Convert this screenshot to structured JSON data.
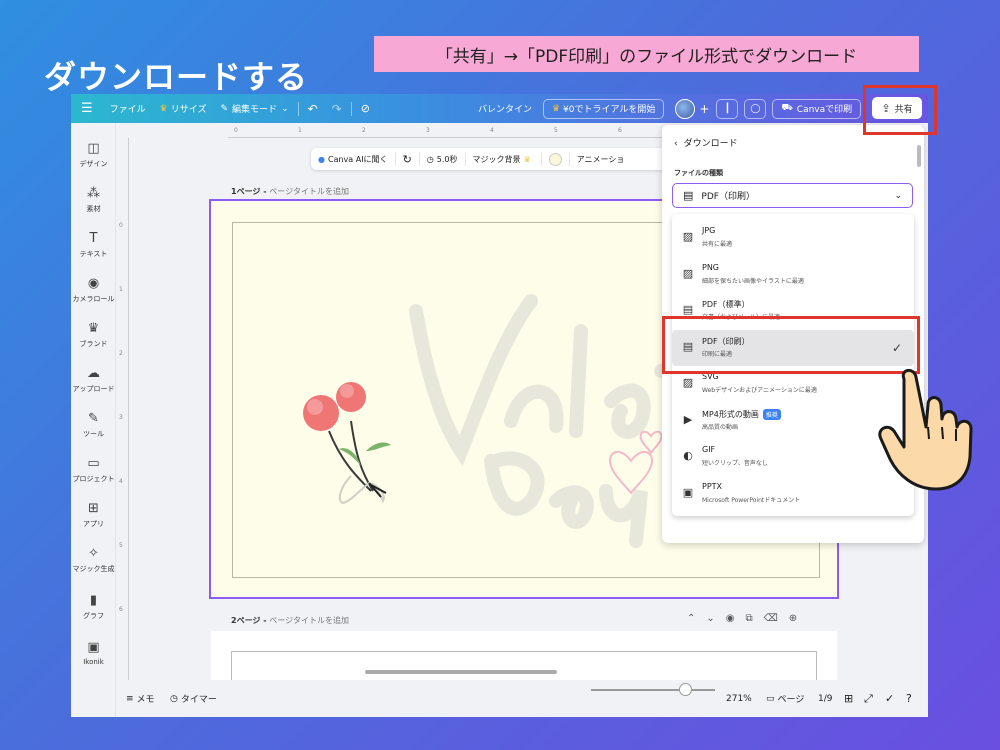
{
  "slide": {
    "title": "ダウンロードする",
    "caption": "「共有」→「PDF印刷」のファイル形式でダウンロード"
  },
  "topbar": {
    "menu_icon": "hamburger-icon",
    "file": "ファイル",
    "resize": "リサイズ",
    "edit_mode": "編集モード",
    "design_name": "バレンタイン",
    "trial": "¥0でトライアルを開始",
    "print": "Canvaで印刷",
    "share": "共有"
  },
  "rail": {
    "items": [
      {
        "label": "デザイン",
        "icon": "layout-icon",
        "glyph": "◫"
      },
      {
        "label": "素材",
        "icon": "shapes-icon",
        "glyph": "⁂"
      },
      {
        "label": "テキスト",
        "icon": "text-icon",
        "glyph": "T"
      },
      {
        "label": "カメラロール",
        "icon": "camera-icon",
        "glyph": "◉"
      },
      {
        "label": "ブランド",
        "icon": "brand-icon",
        "glyph": "♛"
      },
      {
        "label": "アップロード",
        "icon": "cloud-upload-icon",
        "glyph": "☁"
      },
      {
        "label": "ツール",
        "icon": "pen-icon",
        "glyph": "✎"
      },
      {
        "label": "プロジェクト",
        "icon": "folder-icon",
        "glyph": "▭"
      },
      {
        "label": "アプリ",
        "icon": "apps-icon",
        "glyph": "⊞"
      },
      {
        "label": "マジック生成",
        "icon": "magic-icon",
        "glyph": "✧"
      },
      {
        "label": "グラフ",
        "icon": "chart-icon",
        "glyph": "▮"
      },
      {
        "label": "Ikonik",
        "icon": "ikonik-icon",
        "glyph": "▣"
      }
    ]
  },
  "ruler": {
    "top": [
      "0",
      "1",
      "2",
      "3",
      "4",
      "5",
      "6"
    ],
    "left": [
      "0",
      "1",
      "2",
      "3",
      "4",
      "5",
      "6"
    ]
  },
  "context_toolbar": {
    "canva_ai": "Canva AIに聞く",
    "duration": "5.0秒",
    "magic_bg": "マジック背景",
    "animation": "アニメーショ"
  },
  "pages": {
    "page1_num": "1ページ - ",
    "page1_title_ph": "ページタイトルを追加",
    "page2_num": "2ページ - ",
    "page2_title_ph": "ページタイトルを追加"
  },
  "bottombar": {
    "notes": "メモ",
    "timer": "タイマー",
    "zoom": "271%",
    "pages_label": "ページ",
    "page_count": "1/9",
    "zoom_level": 0.76
  },
  "download_panel": {
    "back": "ダウンロード",
    "file_type_label": "ファイルの種類",
    "selected": "PDF（印刷）",
    "options": [
      {
        "title": "JPG",
        "desc": "共有に最適",
        "icon": "image-icon",
        "glyph": "▨"
      },
      {
        "title": "PNG",
        "desc": "細部を保ちたい画像やイラストに最適",
        "icon": "image-icon",
        "glyph": "▨"
      },
      {
        "title": "PDF（標準）",
        "desc": "文書（およびメール）に最適",
        "icon": "document-icon",
        "glyph": "▤"
      },
      {
        "title": "PDF（印刷）",
        "desc": "印刷に最適",
        "icon": "document-icon",
        "glyph": "▤"
      },
      {
        "title": "SVG",
        "desc": "Webデザインおよびアニメーションに最適",
        "icon": "image-icon",
        "glyph": "▨"
      },
      {
        "title": "MP4形式の動画",
        "desc": "高品質の動画",
        "icon": "video-icon",
        "glyph": "▶",
        "badge": "推奨"
      },
      {
        "title": "GIF",
        "desc": "短いクリップ、音声なし",
        "icon": "gif-icon",
        "glyph": "◐"
      },
      {
        "title": "PPTX",
        "desc": "Microsoft PowerPointドキュメント",
        "icon": "presentation-icon",
        "glyph": "▣"
      }
    ]
  },
  "colors": {
    "accent": "#8b5cf6",
    "highlight": "#e0352b",
    "caption_bg": "#f7a8d4",
    "page_bg": "#fefde9"
  }
}
